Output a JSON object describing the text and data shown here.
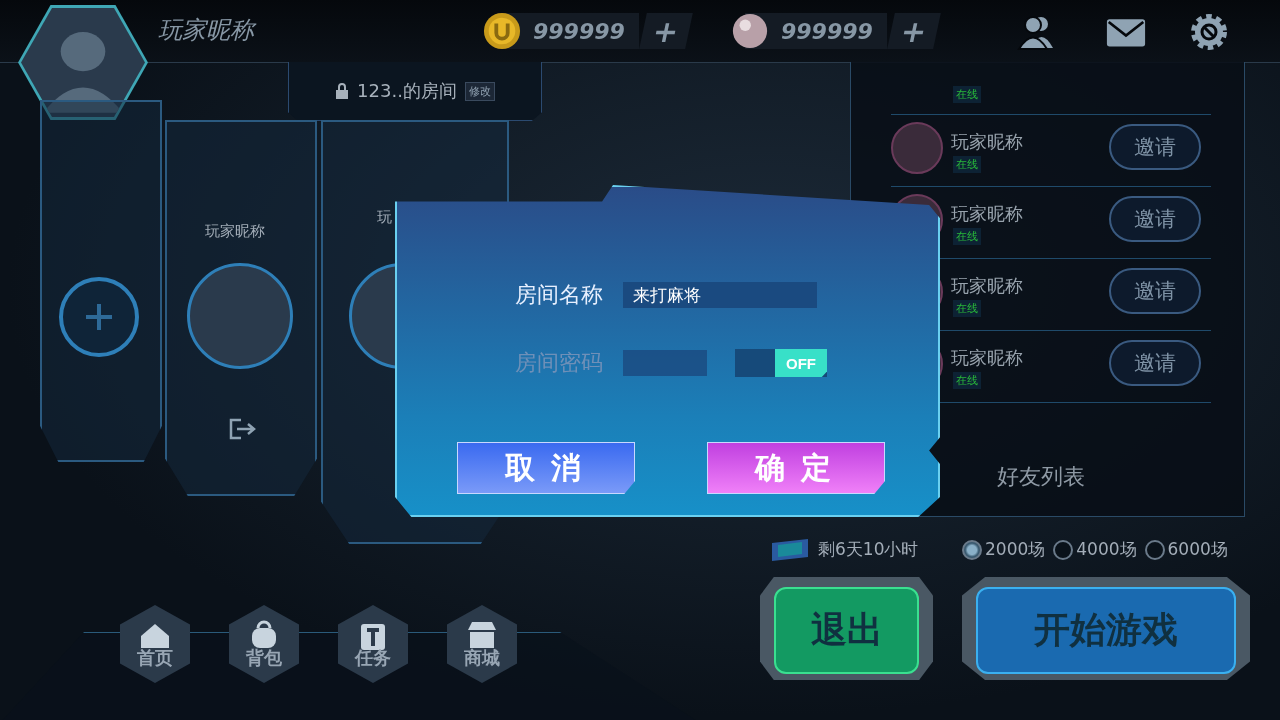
{
  "player": {
    "name": "玩家昵称"
  },
  "currencies": [
    {
      "kind": "coin",
      "amount": "999999",
      "add": "+"
    },
    {
      "kind": "pearl",
      "amount": "999999",
      "add": "+"
    }
  ],
  "room": {
    "title": "123..的房间",
    "edit": "修改"
  },
  "seats": [
    {
      "kind": "empty"
    },
    {
      "kind": "player",
      "name": "玩家昵称"
    },
    {
      "kind": "player",
      "name": "玩"
    }
  ],
  "friends": {
    "rows": [
      {
        "kind": "partial",
        "status": "在线"
      },
      {
        "kind": "full",
        "name": "玩家昵称",
        "status": "在线",
        "action": "邀请"
      },
      {
        "kind": "full",
        "name": "玩家昵称",
        "status": "在线",
        "action": "邀请"
      },
      {
        "kind": "full",
        "name": "玩家昵称",
        "status": "在线",
        "action": "邀请"
      },
      {
        "kind": "full",
        "name": "玩家昵称",
        "status": "在线",
        "action": "邀请"
      }
    ],
    "footer": "好友列表"
  },
  "dialog": {
    "fields": [
      {
        "label": "房间名称",
        "value": "来打麻将",
        "disabled": false
      },
      {
        "label": "房间密码",
        "disabled": true,
        "toggle": {
          "label": "OFF",
          "on": false
        }
      }
    ],
    "buttons": [
      {
        "kind": "cancel",
        "label": "取消"
      },
      {
        "kind": "confirm",
        "label": "确定"
      }
    ]
  },
  "ticket": {
    "remaining": "剩6天10小时"
  },
  "stakes": [
    {
      "label": "2000场",
      "selected": true
    },
    {
      "label": "4000场",
      "selected": false
    },
    {
      "label": "6000场",
      "selected": false
    }
  ],
  "actions": [
    {
      "kind": "exit",
      "label": "退出"
    },
    {
      "kind": "start",
      "label": "开始游戏"
    }
  ],
  "nav": [
    {
      "kind": "home",
      "label": "首页"
    },
    {
      "kind": "bag",
      "label": "背包"
    },
    {
      "kind": "task",
      "label": "任务"
    },
    {
      "kind": "shop",
      "label": "商城"
    }
  ]
}
